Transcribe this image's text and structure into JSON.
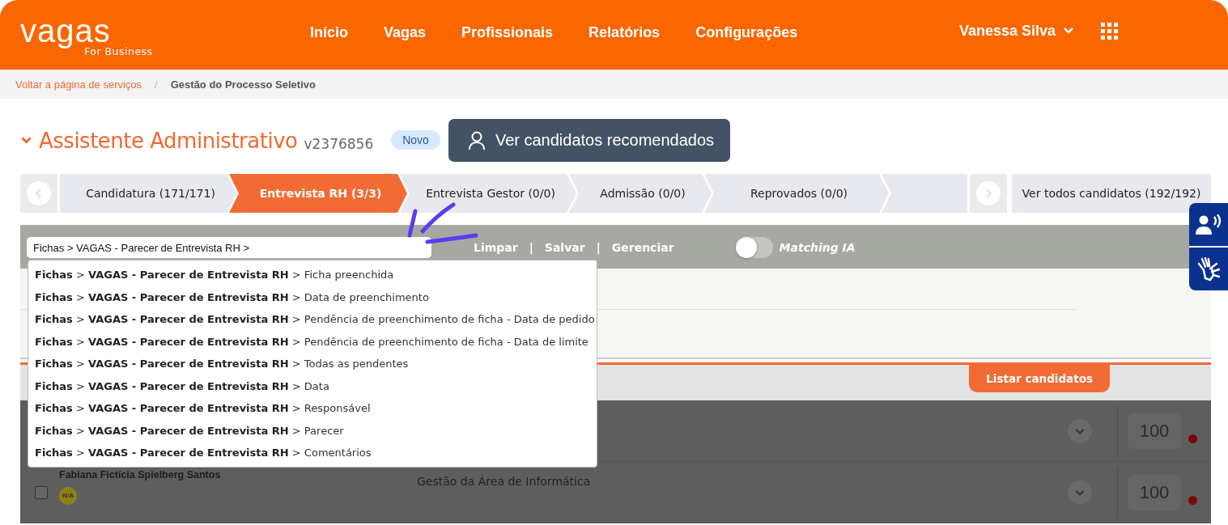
{
  "header": {
    "logo": "vagas",
    "logo_sub": "For Business",
    "nav": [
      {
        "label": "Início"
      },
      {
        "label": "Vagas"
      },
      {
        "label": "Profissionais"
      },
      {
        "label": "Relatórios"
      },
      {
        "label": "Configurações"
      }
    ],
    "user": "Vanessa Silva"
  },
  "breadcrumb": [
    {
      "label": "Voltar a página de serviços",
      "link": true
    },
    {
      "label": "Gestão do Processo Seletivo",
      "link": false
    }
  ],
  "breadcrumb_separator": "/",
  "job": {
    "title": "Assistente Administrativo",
    "code": "v2376856",
    "badge": "Novo",
    "button": "Ver candidatos recomendados"
  },
  "stages": [
    {
      "label": "Candidatura (171/171)",
      "selected": false
    },
    {
      "label": "Entrevista RH (3/3)",
      "selected": true
    },
    {
      "label": "Entrevista Gestor (0/0)",
      "selected": false
    },
    {
      "label": "Admissão (0/0)",
      "selected": false
    },
    {
      "label": "Reprovados (0/0)",
      "selected": false
    }
  ],
  "all_candidates": "Ver todos candidatos (192/192)",
  "filter": {
    "value": "Fichas > VAGAS - Parecer de Entrevista RH >",
    "actions": [
      "Limpar",
      "Salvar",
      "Gerenciar"
    ],
    "separator": "|",
    "toggle_label": "Matching IA",
    "toggle_on": false
  },
  "suggestions": [
    "**Fichas** > **VAGAS - Parecer de Entrevista RH** > Ficha preenchida",
    "**Fichas** > **VAGAS - Parecer de Entrevista RH** > Data de preenchimento",
    "**Fichas** > **VAGAS - Parecer de Entrevista RH** > Pendência de preenchimento de ficha - Data de pedido",
    "**Fichas** > **VAGAS - Parecer de Entrevista RH** > Pendência de preenchimento de ficha - Data de limite",
    "**Fichas** > **VAGAS - Parecer de Entrevista RH** > Todas as pendentes",
    "**Fichas** > **VAGAS - Parecer de Entrevista RH** > Data",
    "**Fichas** > **VAGAS - Parecer de Entrevista RH** > Responsável",
    "**Fichas** > **VAGAS - Parecer de Entrevista RH** > Parecer",
    "**Fichas** > **VAGAS - Parecer de Entrevista RH** > Comentários"
  ],
  "list_button": "Listar candidatos",
  "candidates": [
    {
      "score": "100"
    },
    {
      "name": "Fabiana Fictícia Spielberg Santos",
      "badge": "N/A",
      "area": "Gestão da Área de Informática",
      "score": "100",
      "checked": false
    }
  ]
}
